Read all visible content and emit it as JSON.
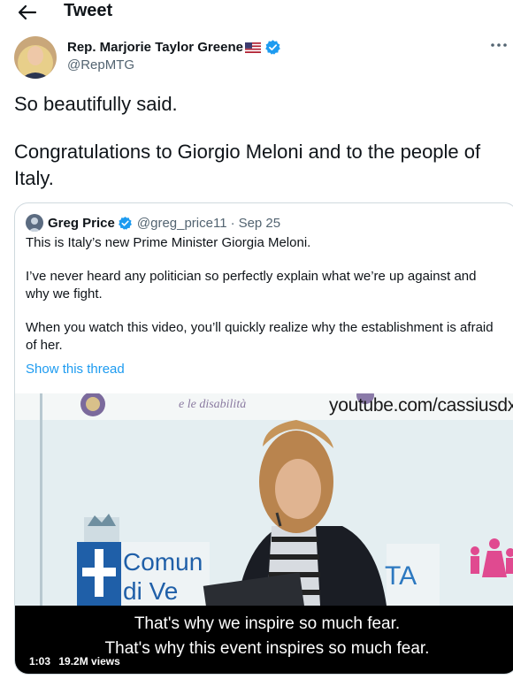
{
  "header": {
    "title": "Tweet"
  },
  "author": {
    "name": "Rep. Marjorie Taylor Greene",
    "handle": "@RepMTG"
  },
  "tweet": {
    "paragraphs": [
      "So beautifully said.",
      "Congratulations to Giorgio Meloni and to the people of Italy."
    ]
  },
  "quoted": {
    "name": "Greg Price",
    "handle": "@greg_price11",
    "separator": "·",
    "date": "Sep 25",
    "paragraphs": [
      "This is Italy’s new Prime Minister Giorgia Meloni.",
      "I’ve never heard any politician so perfectly explain what we’re up against and why we fight.",
      "When you watch this video, you’ll quickly realize why the establishment is afraid of her."
    ],
    "show_thread": "Show this thread",
    "video": {
      "watermark": "youtube.com/cassiusdx",
      "subtitle_line1": "That's why we inspire so much fear.",
      "subtitle_line2": "That's why this event inspires so much fear.",
      "duration": "1:03",
      "views": "19.2M views",
      "banner_text_1": "Comun",
      "banner_text_2": "di Ve",
      "banner_text_3": "TA",
      "script_text": "e le disabilità"
    }
  },
  "colors": {
    "accent": "#1d9bf0",
    "secondary_text": "#536471",
    "border": "#cfd9de"
  },
  "icons": [
    "back-arrow-icon",
    "verified-badge-icon",
    "us-flag-icon",
    "more-options-icon"
  ]
}
